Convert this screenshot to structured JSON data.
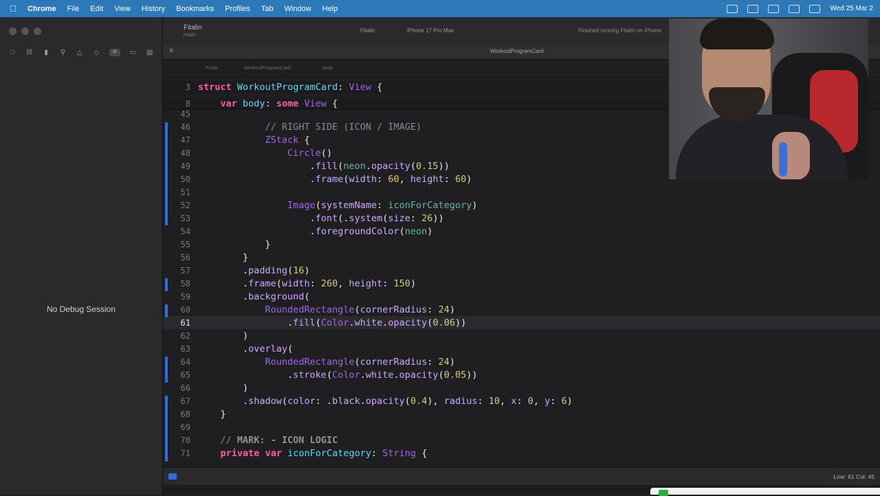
{
  "menubar": {
    "app": "Chrome",
    "items": [
      "File",
      "Edit",
      "View",
      "History",
      "Bookmarks",
      "Profiles",
      "Tab",
      "Window",
      "Help"
    ],
    "datetime": "Wed 25 Mar 2",
    "accent": "#2d78b8"
  },
  "toolbar": {
    "project": "Fitalin",
    "branch": "main",
    "scheme": "Fitalin",
    "device": "iPhone 17 Pro Max",
    "status": "Finished running Fitalin on iPhone"
  },
  "tab": {
    "title": "WorkoutProgramCard"
  },
  "jumpbar": {
    "items": [
      "Fitalin",
      "WorkoutProgramCard",
      "body"
    ]
  },
  "debug": {
    "no_session": "No Debug Session"
  },
  "statusbar": {
    "cursor": "Line: 61  Col: 45"
  },
  "editor": {
    "sticky": [
      {
        "n": "3",
        "html": "<span class=\"kw\">struct</span> <span class=\"tyu\">WorkoutProgramCard</span>: <span class=\"ty\">View</span> {"
      },
      {
        "n": "8",
        "html": "    <span class=\"kw\">var</span> <span class=\"tyu\">body</span>: <span class=\"kw\">some</span> <span class=\"ty\">View</span> {"
      }
    ],
    "lines": [
      {
        "n": "45",
        "html": ""
      },
      {
        "n": "46",
        "html": "            <span class=\"com\">// RIGHT SIDE (ICON / IMAGE)</span>"
      },
      {
        "n": "47",
        "html": "            <span class=\"ty\">ZStack</span> {"
      },
      {
        "n": "48",
        "html": "                <span class=\"ty\">Circle</span>()"
      },
      {
        "n": "49",
        "html": "                    .<span class=\"ty2\">fill</span>(<span class=\"fn\">neon</span>.<span class=\"ty2\">opacity</span>(<span class=\"num\">0.15</span>))"
      },
      {
        "n": "50",
        "html": "                    .<span class=\"ty2\">frame</span>(<span class=\"ty2\">width</span>: <span class=\"num\">60</span>, <span class=\"ty2\">height</span>: <span class=\"num\">60</span>)"
      },
      {
        "n": "51",
        "html": ""
      },
      {
        "n": "52",
        "html": "                <span class=\"ty\">Image</span>(<span class=\"ty2\">systemName</span>: <span class=\"fn\">iconForCategory</span>)"
      },
      {
        "n": "53",
        "html": "                    .<span class=\"ty2\">font</span>(.<span class=\"ty2\">system</span>(<span class=\"ty2\">size</span>: <span class=\"num\">26</span>))"
      },
      {
        "n": "54",
        "html": "                    .<span class=\"ty2\">foregroundColor</span>(<span class=\"fn\">neon</span>)"
      },
      {
        "n": "55",
        "html": "            }"
      },
      {
        "n": "56",
        "html": "        }"
      },
      {
        "n": "57",
        "html": "        .<span class=\"ty2\">padding</span>(<span class=\"num\">16</span>)"
      },
      {
        "n": "58",
        "html": "        .<span class=\"ty2\">frame</span>(<span class=\"ty2\">width</span>: <span class=\"num\">260</span>, <span class=\"ty2\">height</span>: <span class=\"num\">150</span>)"
      },
      {
        "n": "59",
        "html": "        .<span class=\"ty2\">background</span>("
      },
      {
        "n": "60",
        "html": "            <span class=\"ty\">RoundedRectangle</span>(<span class=\"ty2\">cornerRadius</span>: <span class=\"num\">24</span>)"
      },
      {
        "n": "61",
        "html": "                .<span class=\"ty2\">fill</span>(<span class=\"ty\">Color</span>.<span class=\"ty2\">white</span>.<span class=\"ty2\">opacity</span>(<span class=\"num\">0.06</span>))"
      },
      {
        "n": "62",
        "html": "        )"
      },
      {
        "n": "63",
        "html": "        .<span class=\"ty2\">overlay</span>("
      },
      {
        "n": "64",
        "html": "            <span class=\"ty\">RoundedRectangle</span>(<span class=\"ty2\">cornerRadius</span>: <span class=\"num\">24</span>)"
      },
      {
        "n": "65",
        "html": "                .<span class=\"ty2\">stroke</span>(<span class=\"ty\">Color</span>.<span class=\"ty2\">white</span>.<span class=\"ty2\">opacity</span>(<span class=\"num\">0.05</span>))"
      },
      {
        "n": "66",
        "html": "        )"
      },
      {
        "n": "67",
        "html": "        .<span class=\"ty2\">shadow</span>(<span class=\"ty2\">color</span>: .<span class=\"ty2\">black</span>.<span class=\"ty2\">opacity</span>(<span class=\"num\">0.4</span>), <span class=\"ty2\">radius</span>: <span class=\"num\">10</span>, <span class=\"ty2\">x</span>: <span class=\"num\">0</span>, <span class=\"ty2\">y</span>: <span class=\"num\">6</span>)"
      },
      {
        "n": "68",
        "html": "    }"
      },
      {
        "n": "69",
        "html": ""
      },
      {
        "n": "70",
        "html": "    <span class=\"com\">// </span><span class=\"mark\">MARK: - ICON LOGIC</span>"
      },
      {
        "n": "71",
        "html": "    <span class=\"kw\">private</span> <span class=\"kw\">var</span> <span class=\"tyu\">iconForCategory</span>: <span class=\"ty\">String</span> {"
      }
    ],
    "current_line": "61"
  }
}
